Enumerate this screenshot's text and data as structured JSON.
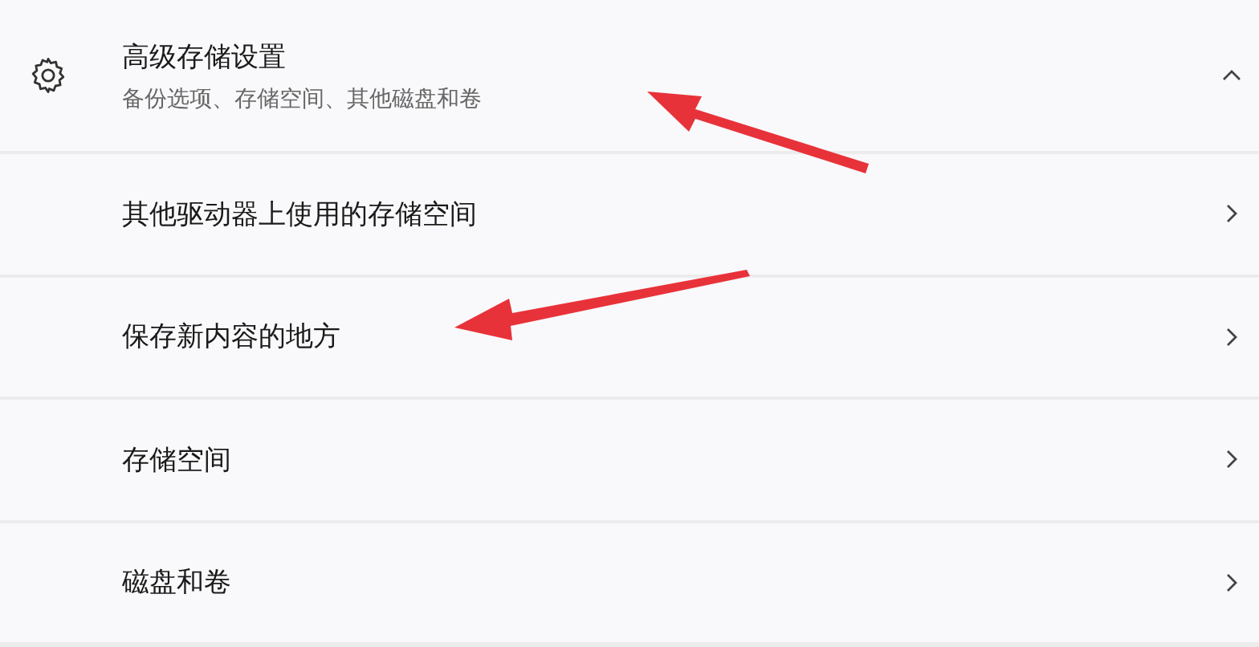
{
  "section": {
    "title": "高级存储设置",
    "subtitle": "备份选项、存储空间、其他磁盘和卷",
    "expanded": true
  },
  "items": [
    {
      "label": "其他驱动器上使用的存储空间"
    },
    {
      "label": "保存新内容的地方"
    },
    {
      "label": "存储空间"
    },
    {
      "label": "磁盘和卷"
    }
  ]
}
